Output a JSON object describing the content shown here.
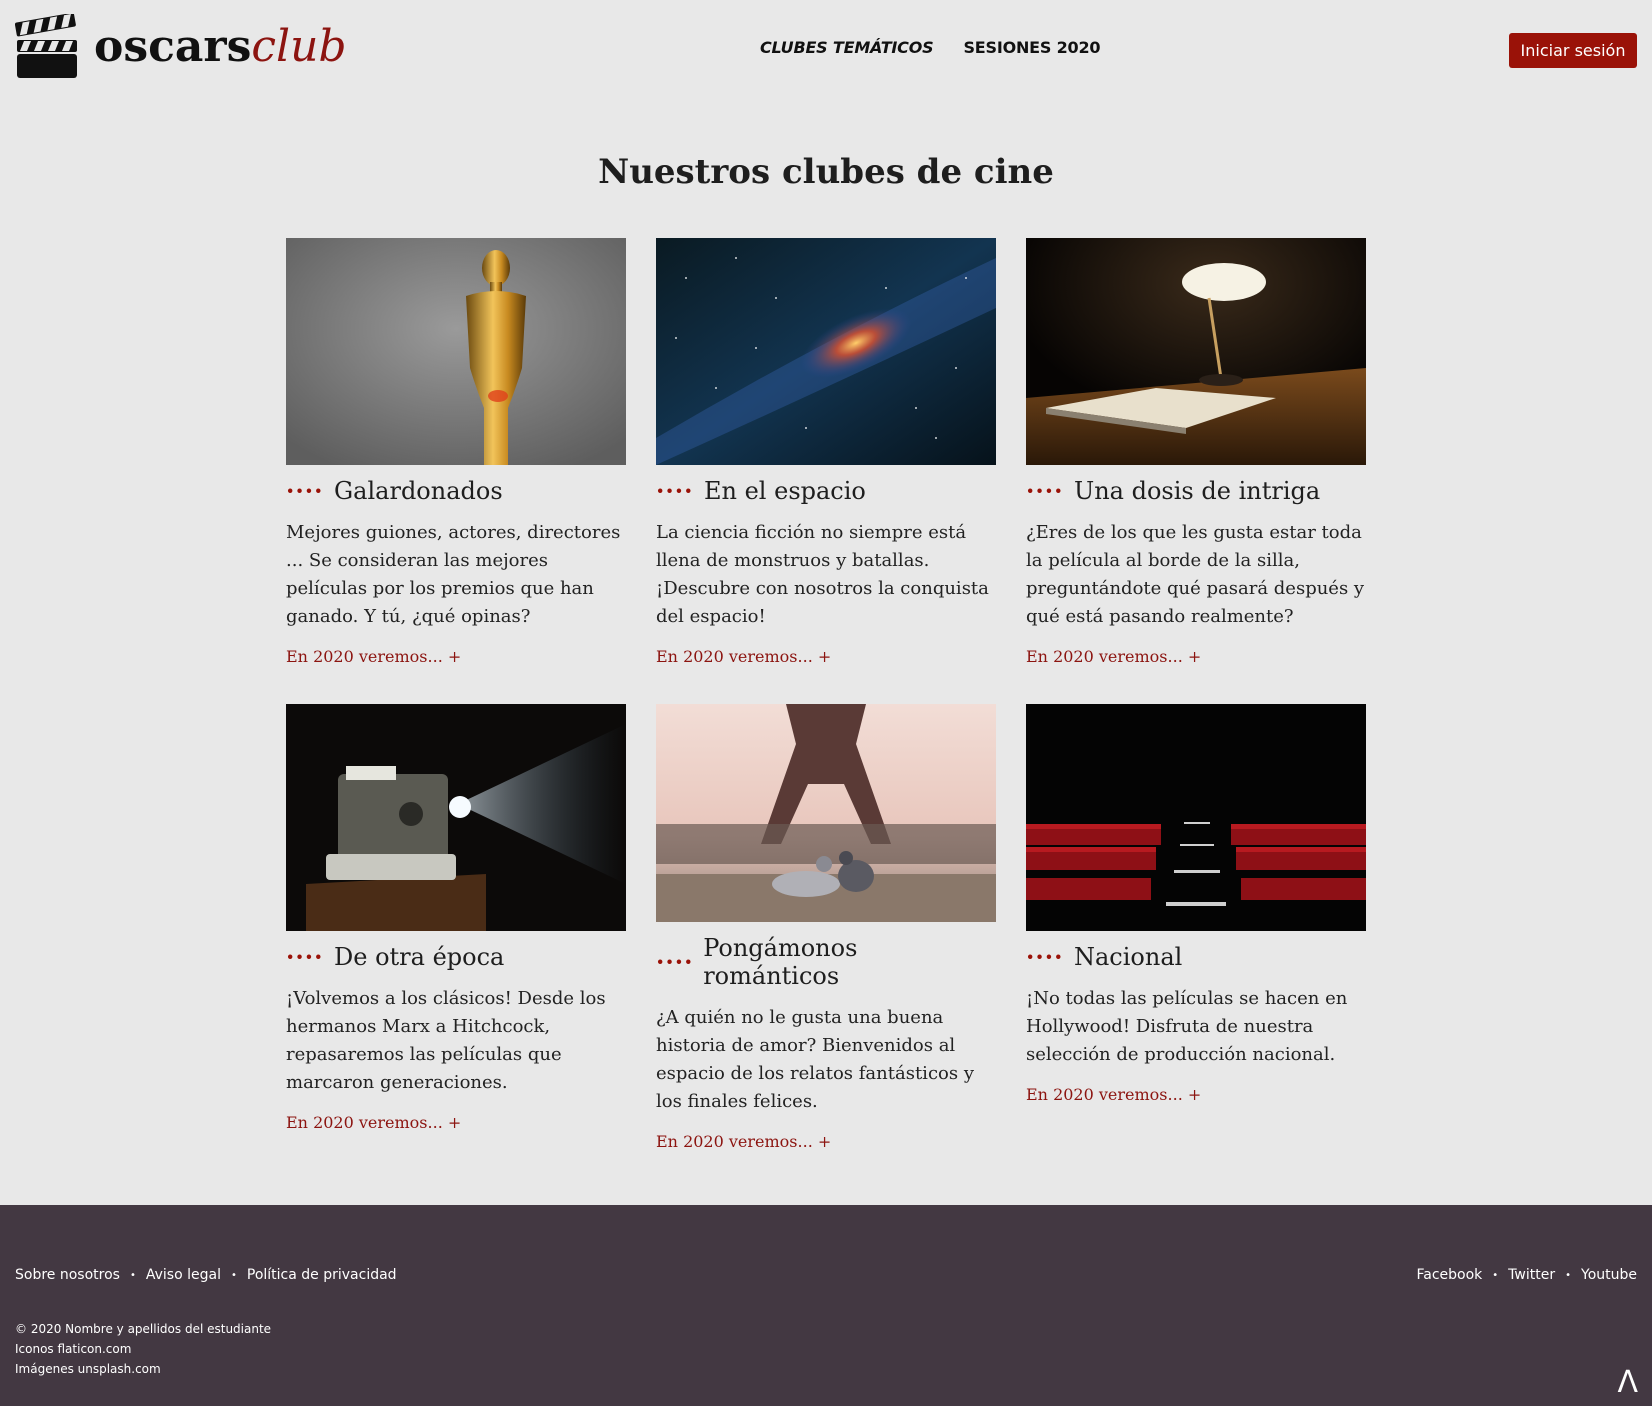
{
  "brand": {
    "bold": "oscars",
    "italic": "club"
  },
  "nav": [
    {
      "label": "CLUBES TEMÁTICOS"
    },
    {
      "label": "SESIONES 2020"
    }
  ],
  "login_label": "Iniciar sesión",
  "page_title": "Nuestros clubes de cine",
  "dots": "····",
  "cards": [
    {
      "title": "Galardonados",
      "desc": "Mejores guiones, actores, directores ... Se consideran las mejores películas por los premios que han ganado. Y tú, ¿qué opinas?",
      "more": "En 2020 veremos... +"
    },
    {
      "title": "En el espacio",
      "desc": "La ciencia ficción no siempre está llena de monstruos y batallas. ¡Descubre con nosotros la conquista del espacio!",
      "more": "En 2020 veremos... +"
    },
    {
      "title": "Una dosis de intriga",
      "desc": "¿Eres de los que les gusta estar toda la película al borde de la silla, preguntándote qué pasará después y qué está pasando realmente?",
      "more": "En 2020 veremos... +"
    },
    {
      "title": "De otra época",
      "desc": "¡Volvemos a los clásicos! Desde los hermanos Marx a Hitchcock, repasaremos las películas que marcaron generaciones.",
      "more": "En 2020 veremos... +"
    },
    {
      "title": "Pongámonos románticos",
      "desc": "¿A quién no le gusta una buena historia de amor? Bienvenidos al espacio de los relatos fantásticos y los finales felices.",
      "more": "En 2020 veremos... +"
    },
    {
      "title": "Nacional",
      "desc": "¡No todas las películas se hacen en Hollywood! Disfruta de nuestra selección de producción nacional.",
      "more": "En 2020 veremos... +"
    }
  ],
  "footer": {
    "links": [
      "Sobre nosotros",
      "Aviso legal",
      "Política de privacidad"
    ],
    "social": [
      "Facebook",
      "Twitter",
      "Youtube"
    ],
    "credits": [
      "© 2020 Nombre y apellidos del estudiante",
      "Iconos flaticon.com",
      "Imágenes unsplash.com"
    ],
    "bullet": "•",
    "top_arrow": "Λ"
  },
  "colors": {
    "accent": "#9a1208",
    "footer_bg": "#433842",
    "page_bg": "#e8e8e8"
  }
}
